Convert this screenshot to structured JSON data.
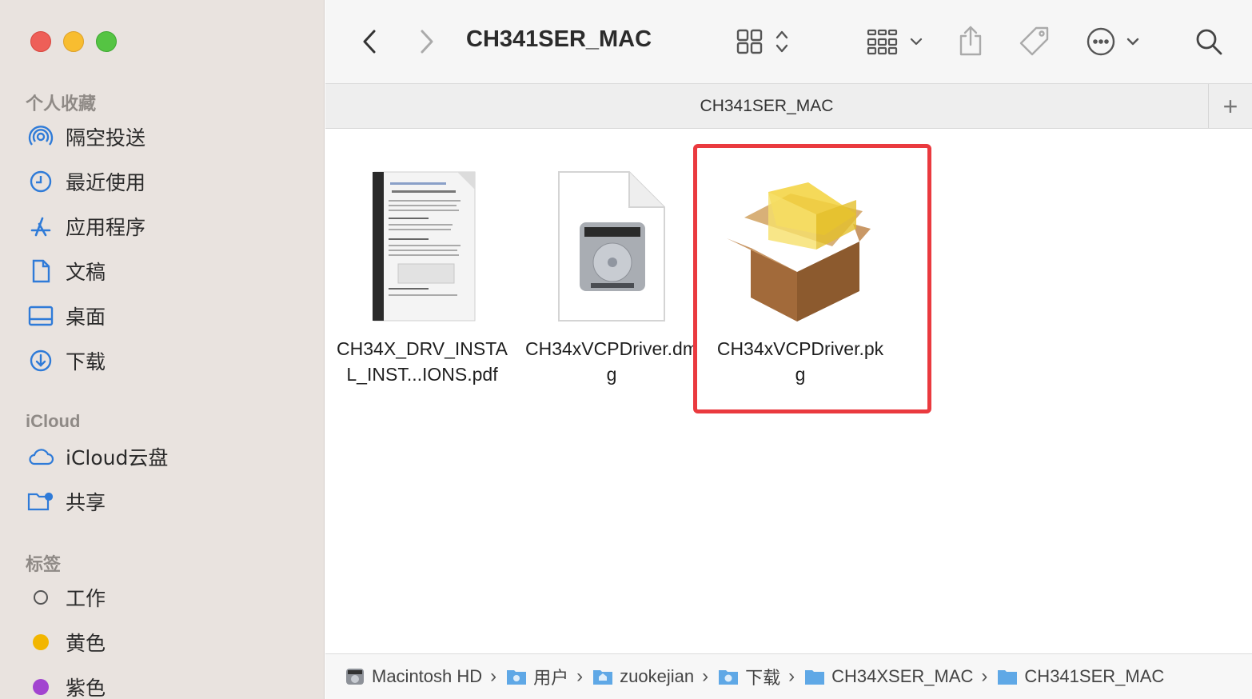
{
  "window": {
    "title": "CH341SER_MAC"
  },
  "sidebar": {
    "favorites_title": "个人收藏",
    "favorites": [
      {
        "label": "隔空投送",
        "icon": "airdrop-icon"
      },
      {
        "label": "最近使用",
        "icon": "clock-icon"
      },
      {
        "label": "应用程序",
        "icon": "applications-icon"
      },
      {
        "label": "文稿",
        "icon": "document-icon"
      },
      {
        "label": "桌面",
        "icon": "desktop-icon"
      },
      {
        "label": "下载",
        "icon": "download-icon"
      }
    ],
    "icloud_title": "iCloud",
    "icloud": [
      {
        "label": "iCloud云盘",
        "icon": "cloud-icon"
      },
      {
        "label": "共享",
        "icon": "shared-folder-icon"
      }
    ],
    "tags_title": "标签",
    "tags": [
      {
        "label": "工作",
        "color": "none"
      },
      {
        "label": "黄色",
        "color": "#f2b600"
      },
      {
        "label": "紫色",
        "color": "#a244d0"
      }
    ]
  },
  "tab": {
    "label": "CH341SER_MAC",
    "add": "+"
  },
  "files": [
    {
      "name": "CH34X_DRV_INSTAL_INST...IONS.pdf",
      "icon": "pdf-document-icon"
    },
    {
      "name": "CH34xVCPDriver.dmg",
      "icon": "disk-image-icon"
    },
    {
      "name": "CH34xVCPDriver.pkg",
      "icon": "package-icon",
      "selected": true
    }
  ],
  "pathbar": [
    {
      "label": "Macintosh HD",
      "icon": "hard-drive-icon"
    },
    {
      "label": "用户",
      "icon": "users-folder-icon"
    },
    {
      "label": "zuokejian",
      "icon": "home-folder-icon"
    },
    {
      "label": "下载",
      "icon": "downloads-folder-icon"
    },
    {
      "label": "CH34XSER_MAC",
      "icon": "folder-icon"
    },
    {
      "label": "CH341SER_MAC",
      "icon": "folder-icon"
    }
  ],
  "colors": {
    "accent": "#2f7bd8",
    "selection_box": "#ea3a3f"
  }
}
